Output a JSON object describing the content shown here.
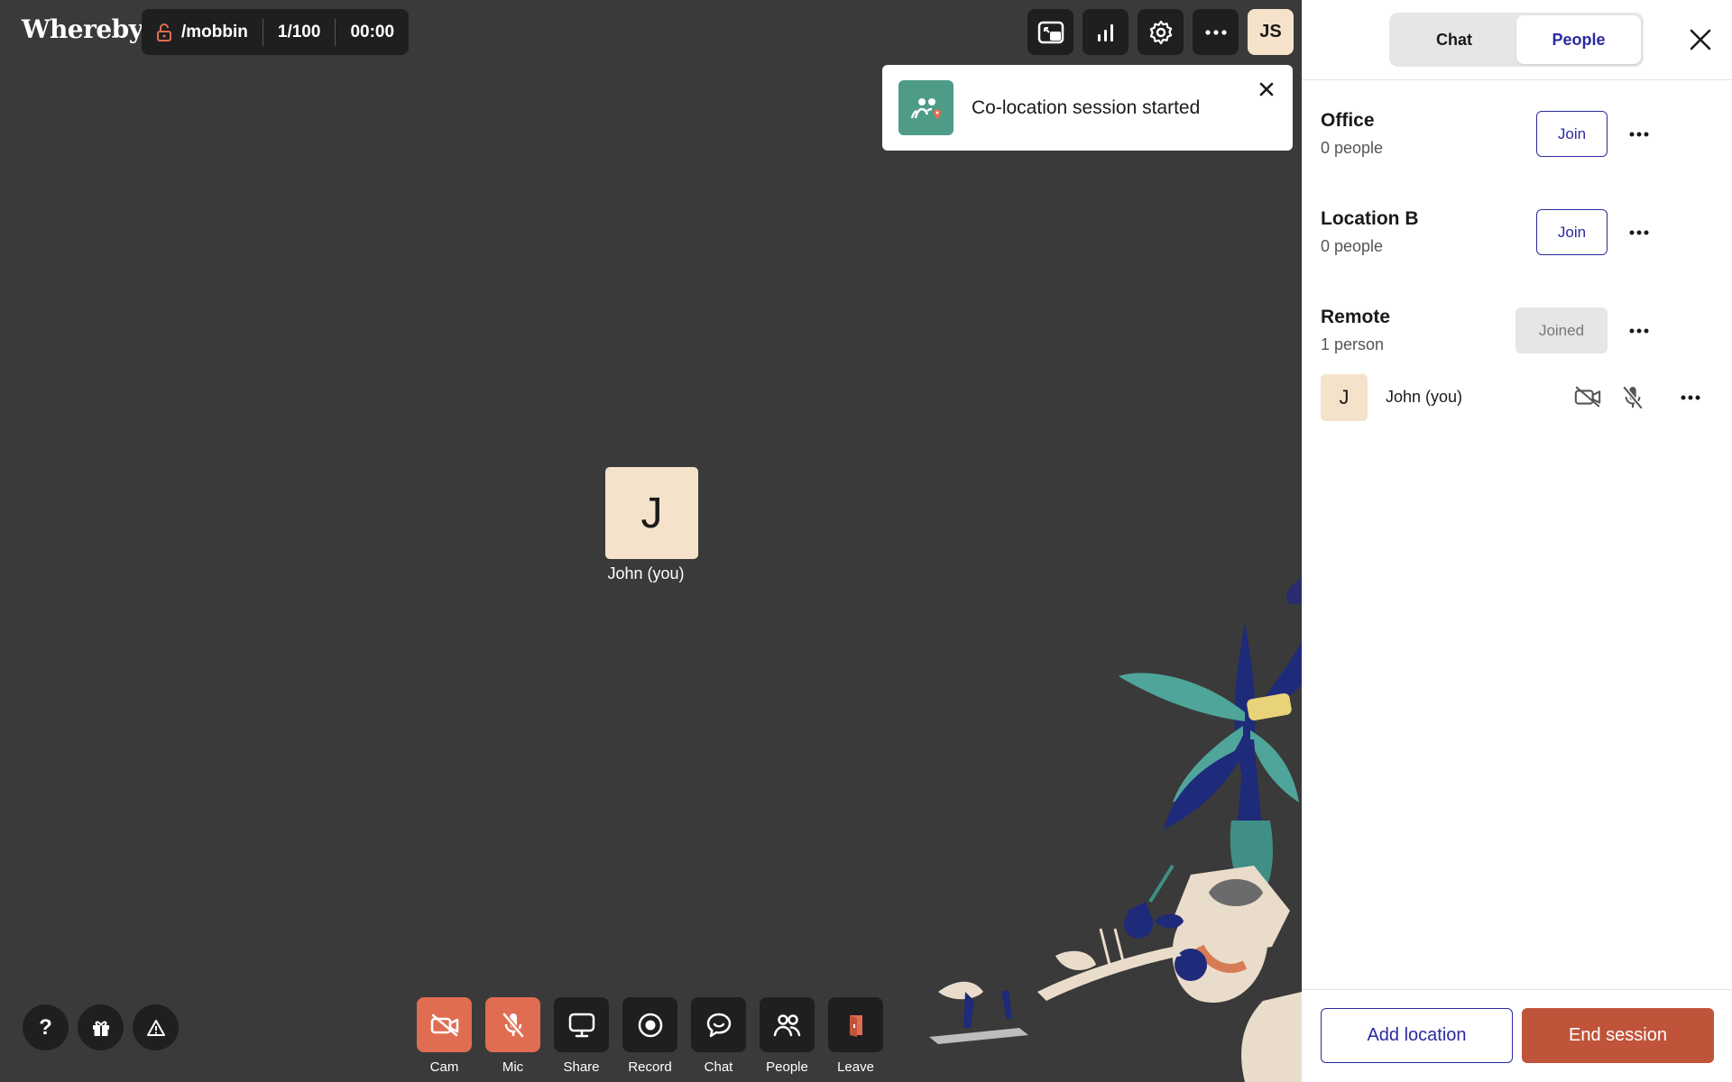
{
  "app": {
    "logo": "Whereby"
  },
  "room": {
    "name": "/mobbin",
    "participants": "1/100",
    "timer": "00:00"
  },
  "top_bar": {
    "user_initials": "JS"
  },
  "toast": {
    "message": "Co-location session started"
  },
  "stage": {
    "tile_initial": "J",
    "tile_name": "John (you)"
  },
  "help": {
    "help_label": "?"
  },
  "controls": [
    {
      "label": "Cam",
      "icon": "camera-off-icon",
      "state": "off"
    },
    {
      "label": "Mic",
      "icon": "mic-off-icon",
      "state": "off"
    },
    {
      "label": "Share",
      "icon": "screen-share-icon"
    },
    {
      "label": "Record",
      "icon": "record-icon"
    },
    {
      "label": "Chat",
      "icon": "chat-icon"
    },
    {
      "label": "People",
      "icon": "people-icon"
    },
    {
      "label": "Leave",
      "icon": "door-icon"
    }
  ],
  "panel": {
    "tabs": [
      {
        "label": "Chat",
        "active": false
      },
      {
        "label": "People",
        "active": true
      }
    ],
    "groups": [
      {
        "name": "Office",
        "count": "0 people",
        "action": "Join"
      },
      {
        "name": "Location B",
        "count": "0 people",
        "action": "Join"
      },
      {
        "name": "Remote",
        "count": "1 person",
        "action": "Joined"
      }
    ],
    "person": {
      "initial": "J",
      "name": "John (you)"
    },
    "footer": {
      "add_location": "Add location",
      "end_session": "End session"
    }
  },
  "colors": {
    "stage_bg": "#3a3a3a",
    "button_dark": "#1f1f1f",
    "button_red": "#e06d52",
    "accent_blue": "#2b2aa0",
    "end_session_red": "#c0543b",
    "avatar_bg": "#f5e2cb",
    "toast_icon_green": "#4e9b87"
  }
}
